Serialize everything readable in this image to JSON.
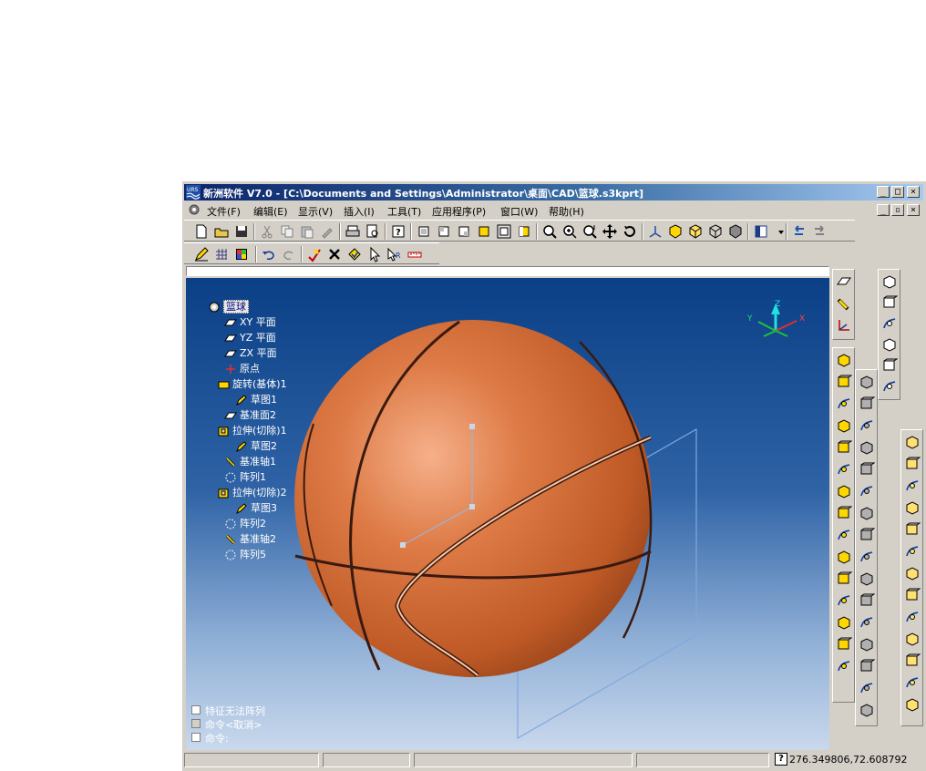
{
  "window": {
    "title": "新洲软件 V7.0 - [C:\\Documents and Settings\\Administrator\\桌面\\CAD\\篮球.s3kprt]",
    "app_icon": "urs-logo-icon"
  },
  "title_controls": [
    "_",
    "□",
    "×"
  ],
  "doc_controls": [
    "_",
    "▫",
    "×"
  ],
  "menu": [
    {
      "label": "文件(F)"
    },
    {
      "label": "编辑(E)"
    },
    {
      "label": "显示(V)"
    },
    {
      "label": "插入(I)"
    },
    {
      "label": "工具(T)"
    },
    {
      "label": "应用程序(P)"
    },
    {
      "label": "窗口(W)"
    },
    {
      "label": "帮助(H)"
    }
  ],
  "feature_tree": {
    "root": "篮球",
    "nodes": [
      {
        "label": "XY 平面",
        "icon": "datum-plane-icon"
      },
      {
        "label": "YZ 平面",
        "icon": "datum-plane-icon"
      },
      {
        "label": "ZX 平面",
        "icon": "datum-plane-icon"
      },
      {
        "label": "原点",
        "icon": "origin-icon"
      },
      {
        "label": "旋转(基体)1",
        "icon": "revolve-feature-icon"
      },
      {
        "label": "草图1",
        "icon": "sketch-icon"
      },
      {
        "label": "基准面2",
        "icon": "datum-plane-icon"
      },
      {
        "label": "拉伸(切除)1",
        "icon": "extrude-cut-icon"
      },
      {
        "label": "草图2",
        "icon": "sketch-icon"
      },
      {
        "label": "基准轴1",
        "icon": "datum-axis-icon"
      },
      {
        "label": "阵列1",
        "icon": "pattern-icon"
      },
      {
        "label": "拉伸(切除)2",
        "icon": "extrude-cut-icon"
      },
      {
        "label": "草图3",
        "icon": "sketch-icon"
      },
      {
        "label": "阵列2",
        "icon": "pattern-icon"
      },
      {
        "label": "基准轴2",
        "icon": "datum-axis-icon"
      },
      {
        "label": "阵列5",
        "icon": "pattern-icon"
      }
    ]
  },
  "axis_triad": {
    "x": "X",
    "y": "Y",
    "z": "Z"
  },
  "console": {
    "lines": [
      "特征无法阵列",
      "命令<取消>",
      "命令:"
    ]
  },
  "status": {
    "help_glyph": "?",
    "coordinates": "276.349806,72.608792"
  },
  "colors": {
    "ball": "#d06a34",
    "seam": "#2a1a1a",
    "viewport_top": "#0b3f86",
    "viewport_bottom": "#c9d8ec",
    "titlebar": "#0a246a"
  }
}
